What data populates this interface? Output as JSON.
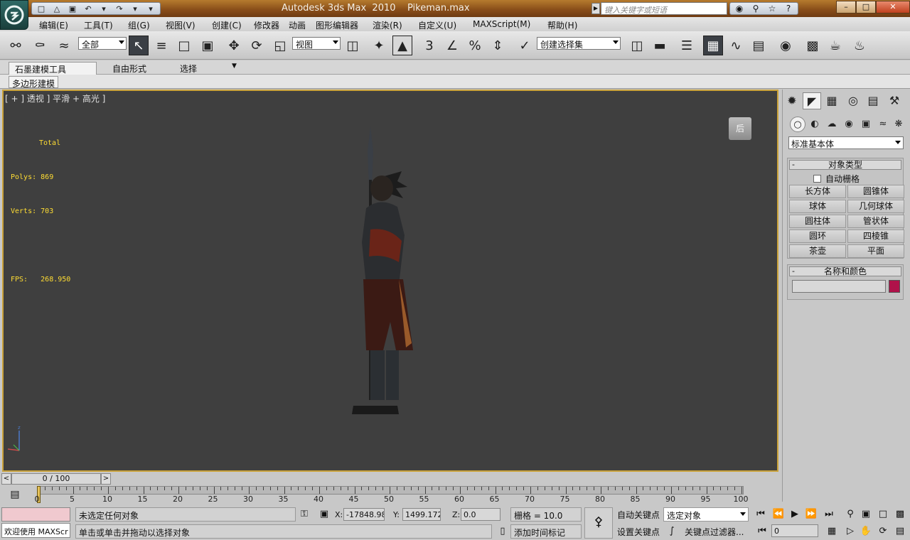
{
  "titlebar": {
    "app_title": "Autodesk 3ds Max  2010",
    "file_name": "Pikeman.max",
    "search_placeholder": "键入关键字或短语",
    "quick_access": [
      "□",
      "△",
      "▣",
      "↶",
      "▾",
      "↷",
      "▾",
      "▾"
    ],
    "window_buttons": [
      "–",
      "□",
      "✕"
    ]
  },
  "menu": [
    "编辑(E)",
    "工具(T)",
    "组(G)",
    "视图(V)",
    "创建(C)",
    "修改器",
    "动画",
    "图形编辑器",
    "渲染(R)",
    "自定义(U)",
    "MAXScript(M)",
    "帮助(H)"
  ],
  "toolbar": {
    "selection_filter": "全部",
    "ref_coord": "视图",
    "named_selection": "创建选择集"
  },
  "ribbon": {
    "tabs": [
      "石墨建模工具",
      "自由形式",
      "选择"
    ],
    "panel": "多边形建模"
  },
  "viewport": {
    "label": "[ + ] 透视 ] 平滑 + 高光 ]",
    "stats_header": "Total",
    "polys_label": "Polys:",
    "polys": "869",
    "verts_label": "Verts:",
    "verts": "703",
    "fps_label": "FPS:",
    "fps": "268.950",
    "viewcube_label": "后"
  },
  "command_panel": {
    "primitive_type": "标准基本体",
    "object_type_title": "对象类型",
    "autogrid_label": "自动栅格",
    "objects": [
      "长方体",
      "圆锥体",
      "球体",
      "几何球体",
      "圆柱体",
      "管状体",
      "圆环",
      "四棱锥",
      "茶壶",
      "平面"
    ],
    "name_color_title": "名称和颜色",
    "object_color": "#b0124a"
  },
  "timeline": {
    "frame_display": "0 / 100",
    "ticks": [
      "0",
      "5",
      "10",
      "15",
      "20",
      "25",
      "30",
      "35",
      "40",
      "45",
      "50",
      "55",
      "60",
      "65",
      "70",
      "75",
      "80",
      "85",
      "90",
      "95",
      "100"
    ]
  },
  "status": {
    "maxscript_label": "欢迎使用 MAXScr",
    "selection_status": "未选定任何对象",
    "prompt": "单击或单击并拖动以选择对象",
    "x_label": "X:",
    "x_value": "-17848.98",
    "y_label": "Y:",
    "y_value": "1499.172",
    "z_label": "Z:",
    "z_value": "0.0",
    "grid": "栅格 = 10.0",
    "add_time_tag": "添加时间标记",
    "auto_key": "自动关键点",
    "set_key": "设置关键点",
    "selected_object": "选定对象",
    "key_filters": "关键点过滤器...",
    "current_frame": "0"
  }
}
